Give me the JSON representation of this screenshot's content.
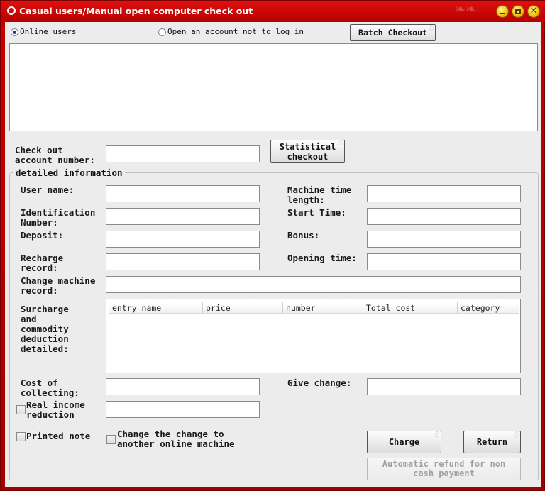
{
  "window": {
    "title": "Casual users/Manual open computer check out"
  },
  "filters": {
    "online_users_label": "Online users",
    "open_account_label": "Open an account not to log in",
    "selected": "online_users"
  },
  "buttons": {
    "batch_checkout": "Batch Checkout",
    "statistical_checkout_line1": "Statistical",
    "statistical_checkout_line2": "checkout",
    "charge": "Charge",
    "return": "Return",
    "auto_refund_line1": "Automatic refund for non",
    "auto_refund_line2": "cash payment"
  },
  "checkout": {
    "account_label_line1": "Check out",
    "account_label_line2": "account number:",
    "account_value": ""
  },
  "detail": {
    "group_title": "detailed information",
    "user_name_label": "User name:",
    "machine_time_label_line1": "Machine time",
    "machine_time_label_line2": "length:",
    "identification_label_line1": "Identification",
    "identification_label_line2": "Number:",
    "start_time_label": "Start Time:",
    "deposit_label": "Deposit:",
    "bonus_label": "Bonus:",
    "recharge_label_line1": "Recharge",
    "recharge_label_line2": "record:",
    "opening_time_label": "Opening time:",
    "change_machine_label_line1": "Change machine",
    "change_machine_label_line2": "record:",
    "surcharge_label_lines": [
      "Surcharge",
      "and",
      "commodity",
      "deduction",
      "detailed:"
    ],
    "cost_label_line1": "Cost of",
    "cost_label_line2": "collecting:",
    "give_change_label": "Give change:",
    "real_income_label_line1": "Real income",
    "real_income_label_line2": "reduction",
    "printed_note_label": "Printed note",
    "change_machine_cb_line1": "Change the change to",
    "change_machine_cb_line2": "another online machine"
  },
  "table": {
    "columns": [
      "entry name",
      "price",
      "number",
      "Total cost",
      "category"
    ]
  },
  "icons": {
    "window_icon": "app-circle-icon",
    "minimize": "minimize-icon",
    "maximize": "maximize-icon",
    "close": "close-icon"
  }
}
